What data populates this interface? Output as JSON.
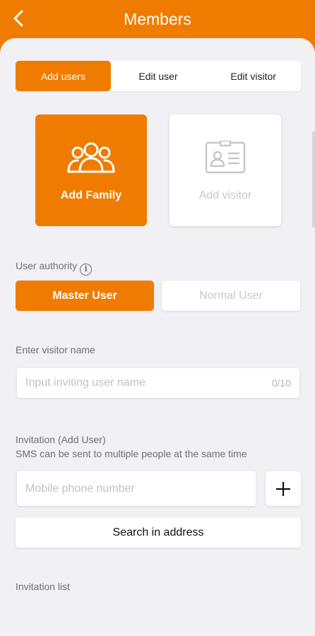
{
  "header": {
    "title": "Members",
    "back_icon": "chevron-left-icon"
  },
  "tabs": [
    {
      "label": "Add users",
      "active": true
    },
    {
      "label": "Edit user",
      "active": false
    },
    {
      "label": "Edit visitor",
      "active": false
    }
  ],
  "cards": {
    "family": {
      "label": "Add Family",
      "icon": "group-icon",
      "selected": true
    },
    "visitor": {
      "label": "Add visitor",
      "icon": "id-card-icon",
      "selected": false
    }
  },
  "authority": {
    "label": "User authority",
    "info_icon": "info-icon",
    "options": [
      {
        "label": "Master User",
        "selected": true
      },
      {
        "label": "Normal User",
        "selected": false
      }
    ]
  },
  "visitor_name": {
    "label": "Enter visitor name",
    "placeholder": "Input inviting user name",
    "counter": "0/10"
  },
  "invitation": {
    "label": "Invitation (Add User)",
    "hint": "SMS can be sent to multiple people at the same time",
    "phone_placeholder": "Mobile phone number",
    "add_icon": "plus-icon",
    "search_label": "Search in address"
  },
  "invitation_list": {
    "label": "Invitation list"
  },
  "colors": {
    "accent": "#ef7c00",
    "background": "#f1f1f5",
    "muted": "#c8c8cc"
  }
}
